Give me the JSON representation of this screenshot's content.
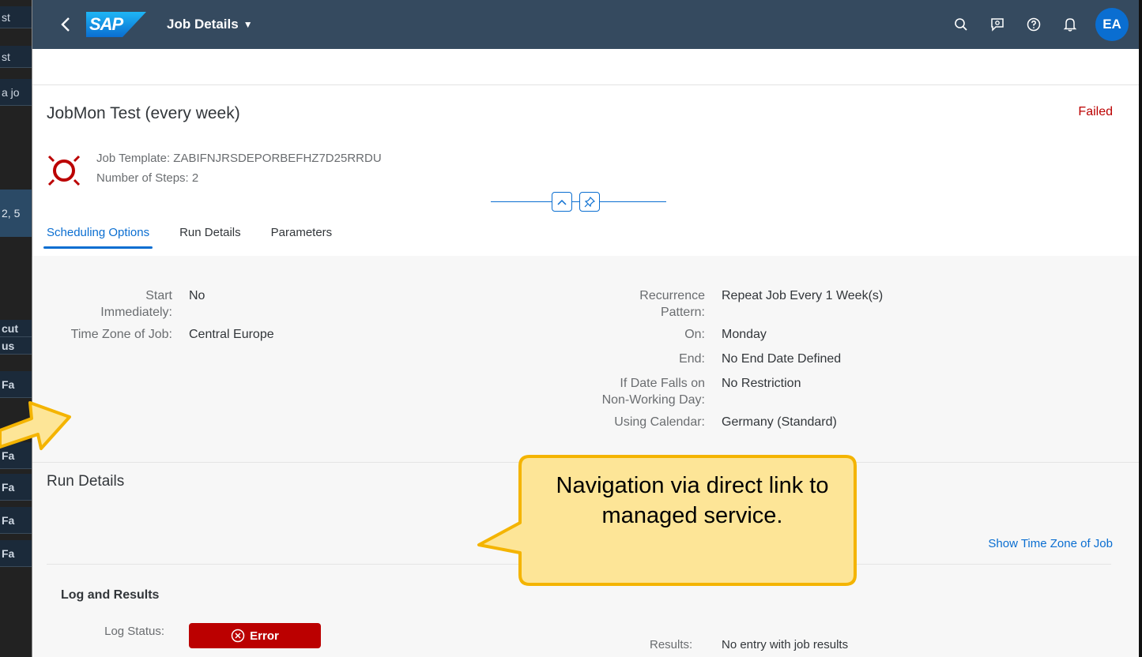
{
  "background_app": {
    "rows": [
      "st",
      "st",
      "a jo",
      "2, 5",
      "cut",
      "us",
      "Fa",
      "F",
      "Fa",
      "Fa",
      "Fa",
      "Fa"
    ]
  },
  "shell": {
    "logo_text": "SAP",
    "app_title": "Job Details",
    "avatar_initials": "EA",
    "icons": [
      "back-icon",
      "search-icon",
      "feedback-icon",
      "help-icon",
      "notifications-icon"
    ]
  },
  "header": {
    "title": "JobMon Test (every week)",
    "status": "Failed",
    "job_template": "Job Template: ZABIFNJRSDEPORBEFHZ7D25RRDU",
    "number_of_steps": "Number of Steps: 2"
  },
  "tabs": [
    {
      "label": "Scheduling Options",
      "active": true
    },
    {
      "label": "Run Details",
      "active": false
    },
    {
      "label": "Parameters",
      "active": false
    }
  ],
  "scheduling": {
    "left": [
      {
        "label_line1": "Start",
        "label_line2": "Immediately:",
        "value": "No"
      },
      {
        "label_line1": "Time Zone of Job:",
        "label_line2": "",
        "value": "Central Europe"
      }
    ],
    "right": [
      {
        "label_line1": "Recurrence",
        "label_line2": "Pattern:",
        "value": "Repeat Job Every 1 Week(s)"
      },
      {
        "label_line1": "On:",
        "label_line2": "",
        "value": "Monday"
      },
      {
        "label_line1": "End:",
        "label_line2": "",
        "value": "No End Date Defined"
      },
      {
        "label_line1": "If Date Falls on",
        "label_line2": "Non-Working Day:",
        "value": "No Restriction"
      },
      {
        "label_line1": "Using Calendar:",
        "label_line2": "",
        "value": "Germany (Standard)"
      }
    ]
  },
  "run_details": {
    "section_title": "Run Details",
    "show_tz_link": "Show Time Zone of Job",
    "log_results_title": "Log and Results",
    "log_status_label": "Log Status:",
    "log_status_value": "Error",
    "results_label": "Results:",
    "results_value": "No entry with job results"
  },
  "callout": {
    "text": "Navigation via direct link to managed service.",
    "fill_color": "#fde597",
    "border_color": "#f4b400"
  },
  "colors": {
    "shell": "#354a5f",
    "accent": "#0a6ed1",
    "error": "#bb0000"
  }
}
